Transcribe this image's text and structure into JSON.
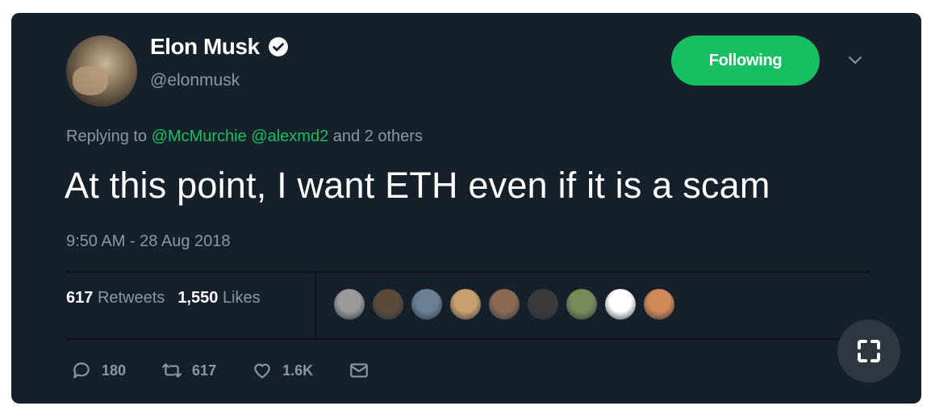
{
  "author": {
    "name": "Elon Musk",
    "handle": "@elonmusk",
    "verified": true
  },
  "follow_button": {
    "label": "Following"
  },
  "reply": {
    "prefix": "Replying to",
    "mention1": "@McMurchie",
    "mention2": "@alexmd2",
    "suffix": "and 2 others"
  },
  "tweet": {
    "text": "At this point, I want ETH even if it is a scam",
    "timestamp": "9:50 AM - 28 Aug 2018"
  },
  "stats": {
    "retweets_count": "617",
    "retweets_label": "Retweets",
    "likes_count": "1,550",
    "likes_label": "Likes"
  },
  "liker_avatars": [
    "#9a9a9a",
    "#5a4a3a",
    "#6b7f96",
    "#c9a070",
    "#8a6a55",
    "#3a3a3a",
    "#7a8a5a",
    "#ffffff",
    "#d08a5a"
  ],
  "actions": {
    "replies": "180",
    "retweets": "617",
    "likes": "1.6K"
  },
  "colors": {
    "background": "#15202b",
    "accent": "#17bf63",
    "muted": "#8899a6"
  },
  "icons": [
    "verified-badge-icon",
    "chevron-down-icon",
    "reply-icon",
    "retweet-icon",
    "like-icon",
    "message-icon",
    "expand-icon"
  ]
}
